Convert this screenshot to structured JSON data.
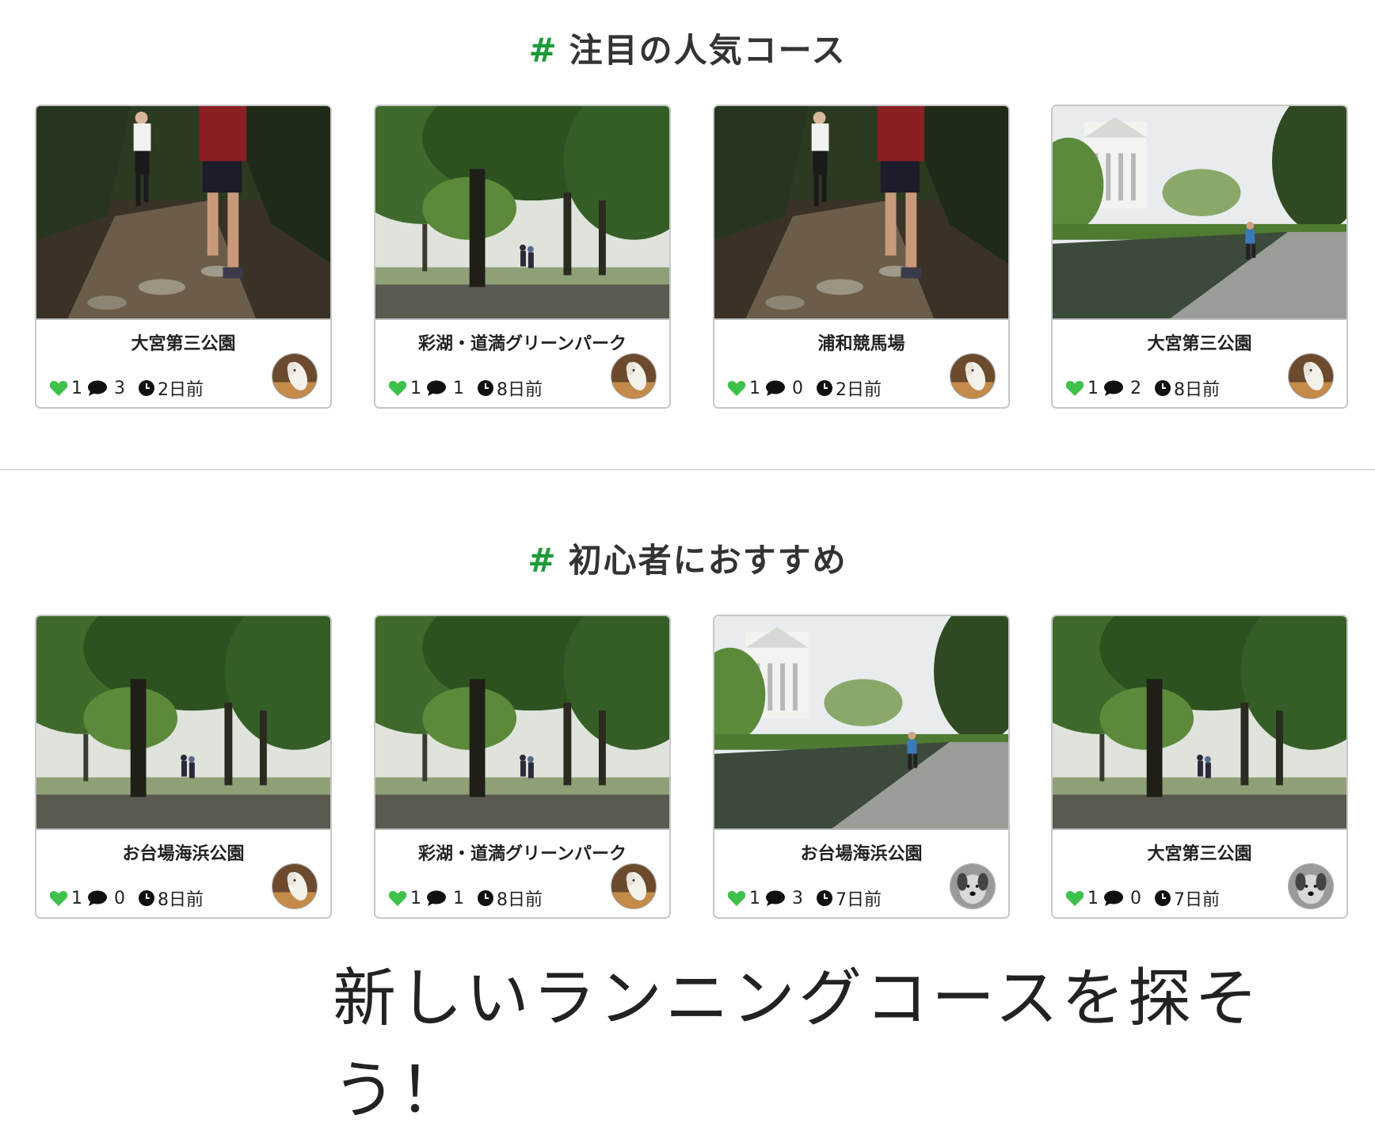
{
  "colors": {
    "accent": "#1e9a3a",
    "heart": "#3ec14a"
  },
  "sections": [
    {
      "hash": "#",
      "title": "注目の人気コース",
      "cards": [
        {
          "title": "大宮第三公園",
          "likes": "1",
          "comments": "3",
          "age": "2日前",
          "photo": "trail-run-icon",
          "avatar": "horse-avatar-icon"
        },
        {
          "title": "彩湖・道満グリーンパーク",
          "likes": "1",
          "comments": "1",
          "age": "8日前",
          "photo": "park-trees-icon",
          "avatar": "horse-avatar-icon"
        },
        {
          "title": "浦和競馬場",
          "likes": "1",
          "comments": "0",
          "age": "2日前",
          "photo": "trail-run-icon",
          "avatar": "horse-avatar-icon"
        },
        {
          "title": "大宮第三公園",
          "likes": "1",
          "comments": "2",
          "age": "8日前",
          "photo": "canal-run-icon",
          "avatar": "horse-avatar-icon"
        }
      ]
    },
    {
      "hash": "#",
      "title": "初心者におすすめ",
      "cards": [
        {
          "title": "お台場海浜公園",
          "likes": "1",
          "comments": "0",
          "age": "8日前",
          "photo": "park-trees-icon",
          "avatar": "horse-avatar-icon"
        },
        {
          "title": "彩湖・道満グリーンパーク",
          "likes": "1",
          "comments": "1",
          "age": "8日前",
          "photo": "park-trees-icon",
          "avatar": "horse-avatar-icon"
        },
        {
          "title": "お台場海浜公園",
          "likes": "1",
          "comments": "3",
          "age": "7日前",
          "photo": "canal-run-icon",
          "avatar": "dog-avatar-icon"
        },
        {
          "title": "大宮第三公園",
          "likes": "1",
          "comments": "0",
          "age": "7日前",
          "photo": "park-trees-icon",
          "avatar": "dog-avatar-icon"
        }
      ]
    }
  ],
  "footer": {
    "text": "新しいランニングコースを探そう！"
  }
}
